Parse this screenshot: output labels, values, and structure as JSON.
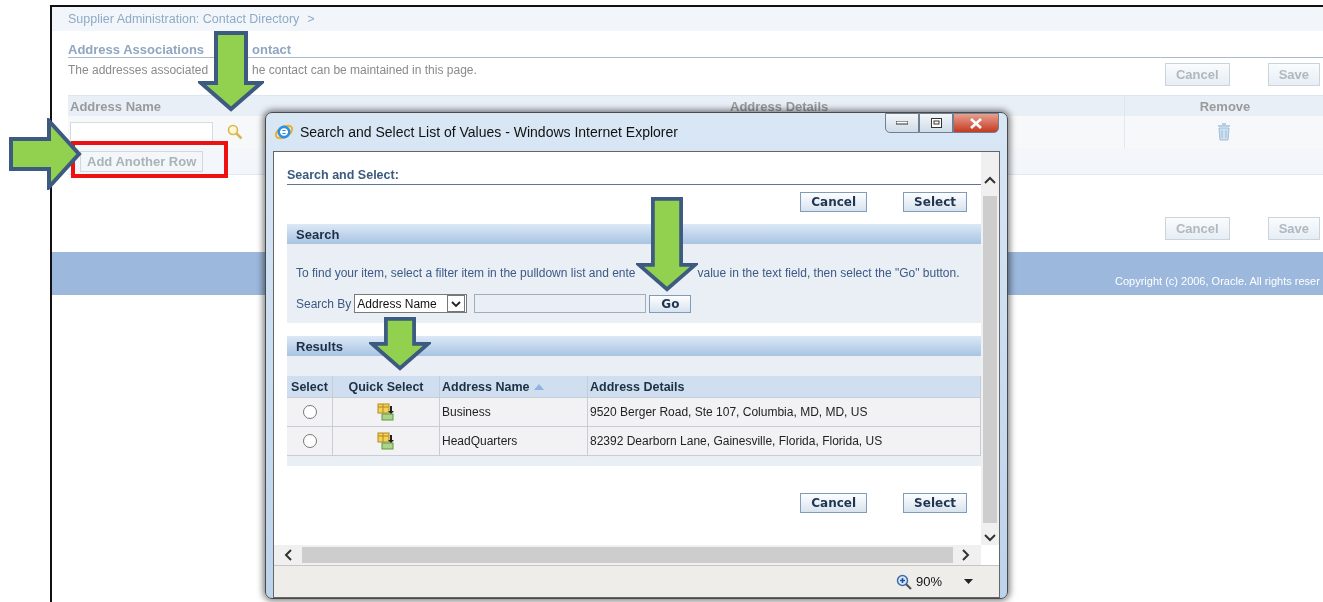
{
  "page": {
    "breadcrumb": "Supplier Administration: Contact Directory",
    "breadcrumb_separator": ">",
    "title_parts": [
      "Address Associations",
      "ontact"
    ],
    "description_parts": [
      "The addresses associated",
      "he contact can be maintained in this page."
    ],
    "buttons": [
      "Cancel",
      "Save"
    ],
    "table": {
      "columns": [
        "Address Name",
        "Address Details",
        "Remove"
      ],
      "add_row_button": "Add Another Row"
    },
    "bottom_buttons": [
      "Cancel",
      "Save"
    ],
    "footer": "Copyright (c) 2006, Oracle. All rights reser"
  },
  "dialog": {
    "title": "Search and Select List of Values - Windows Internet Explorer",
    "heading": "Search and Select:",
    "buttons": [
      "Cancel",
      "Select"
    ],
    "search": {
      "title": "Search",
      "instruction_parts": [
        "To find your item, select a filter item in the pulldown list and ente",
        "value in the text field, then select the \"Go\" button."
      ],
      "search_by_label": "Search By",
      "filter_value": "Address Name",
      "go_button": "Go"
    },
    "results": {
      "title": "Results",
      "columns": [
        {
          "label": "Select",
          "sorted": false
        },
        {
          "label": "Quick Select",
          "sorted": false
        },
        {
          "label": "Address Name",
          "sorted": true
        },
        {
          "label": "Address Details",
          "sorted": false
        }
      ],
      "rows": [
        {
          "name": "Business",
          "details": "9520 Berger Road, Ste 107, Columbia, MD, MD, US",
          "selected": false
        },
        {
          "name": "HeadQuarters",
          "details": "82392 Dearborn Lane, Gainesville, Florida, Florida, US",
          "selected": false
        }
      ]
    },
    "bottom_buttons": [
      "Cancel",
      "Select"
    ],
    "zoom": "90%"
  }
}
